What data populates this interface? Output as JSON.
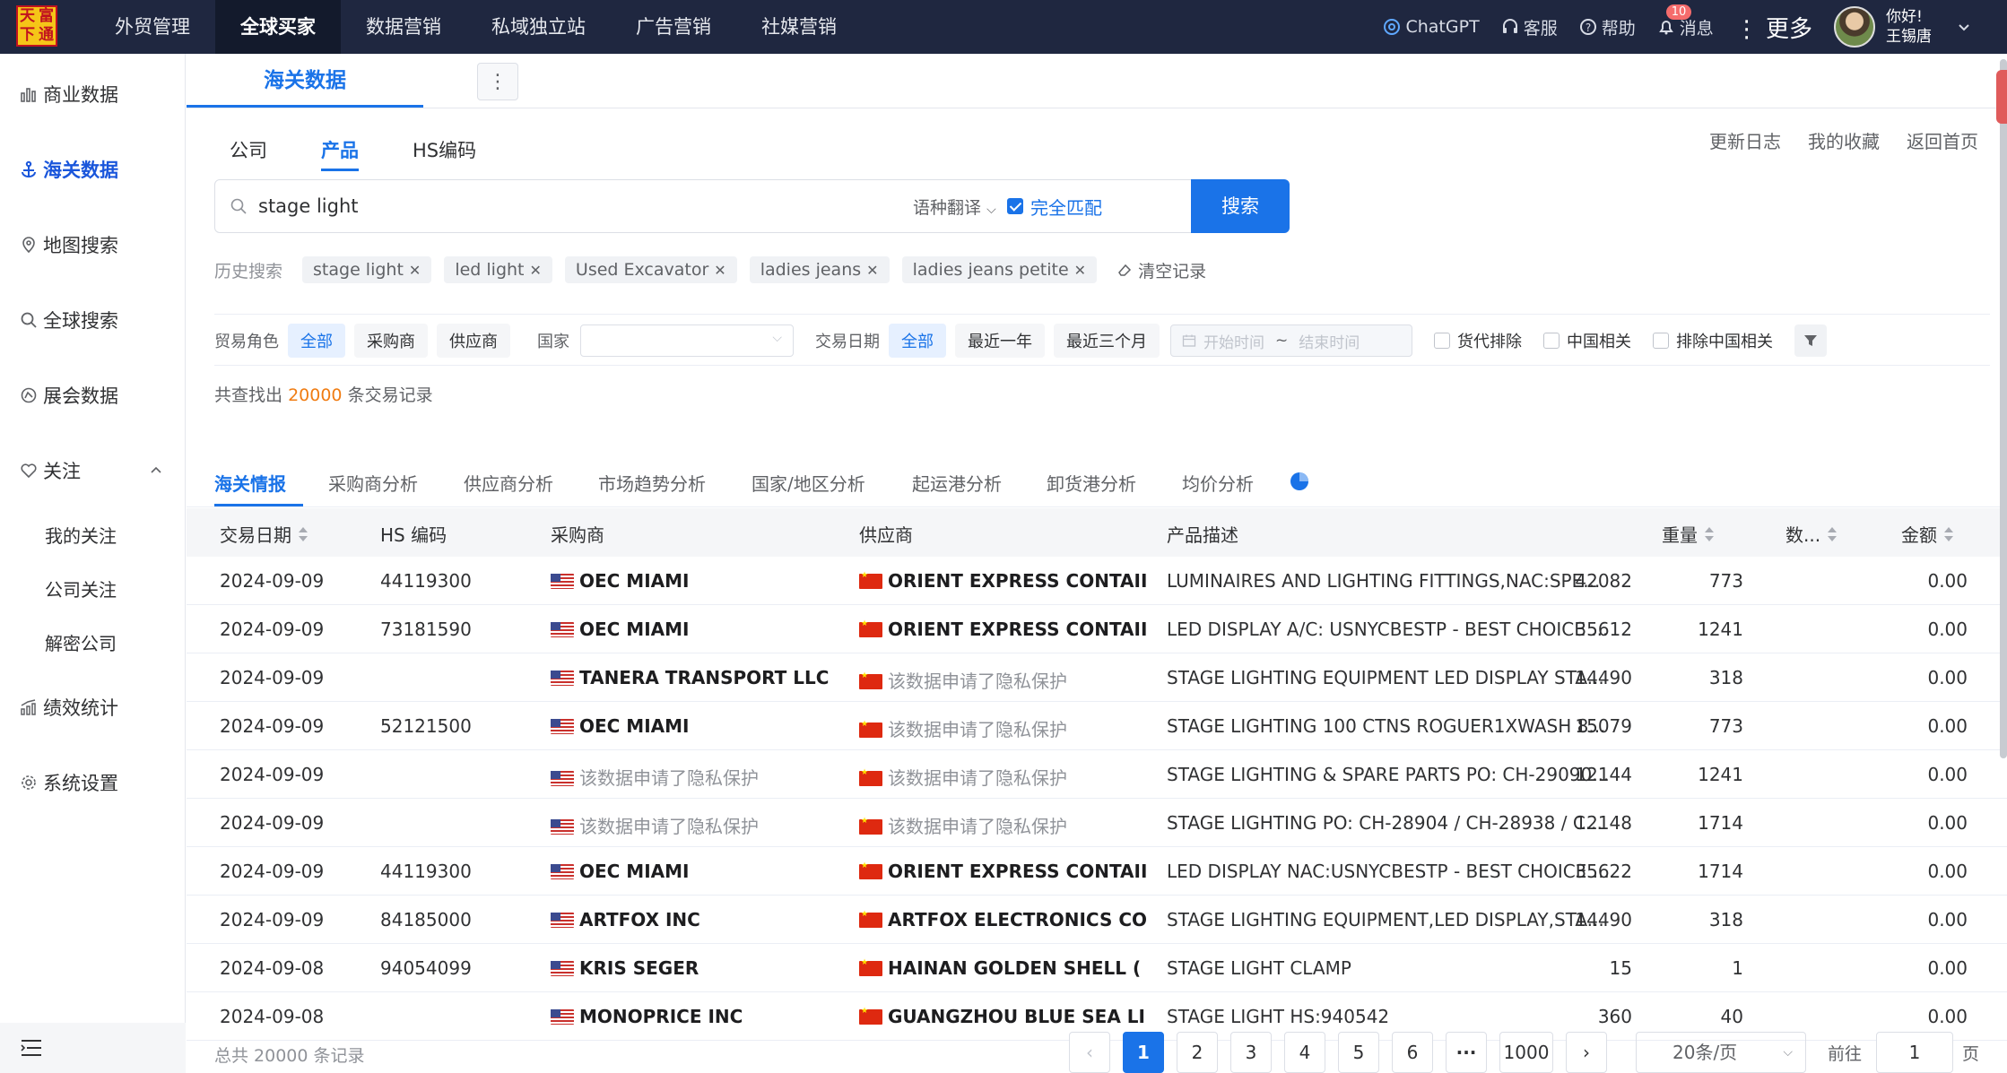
{
  "logo": {
    "chars": [
      "天",
      "富",
      "下",
      "通"
    ]
  },
  "topnav": [
    {
      "label": "外贸管理",
      "active": false
    },
    {
      "label": "全球买家",
      "active": true
    },
    {
      "label": "数据营销",
      "active": false
    },
    {
      "label": "私域独立站",
      "active": false
    },
    {
      "label": "广告营销",
      "active": false
    },
    {
      "label": "社媒营销",
      "active": false
    }
  ],
  "topright": {
    "chatgpt": "ChatGPT",
    "service": "客服",
    "help": "帮助",
    "messages": "消息",
    "message_count": "10",
    "more": "⋮ 更多",
    "greeting": "你好!",
    "username": "王锡唐"
  },
  "sidebar": {
    "items": [
      "商业数据",
      "海关数据",
      "地图搜索",
      "全球搜索",
      "展会数据",
      "关注",
      "绩效统计",
      "系统设置"
    ],
    "sub": [
      "我的关注",
      "公司关注",
      "解密公司"
    ]
  },
  "page_tab": "海关数据",
  "subtabs": [
    "公司",
    "产品",
    "HS编码"
  ],
  "toplinks": [
    "更新日志",
    "我的收藏",
    "返回首页"
  ],
  "search": {
    "value": "stage light",
    "translate": "语种翻译",
    "exact": "完全匹配",
    "button": "搜索"
  },
  "history": {
    "label": "历史搜索",
    "chips": [
      "stage light",
      "led light",
      "Used Excavator",
      "ladies jeans",
      "ladies jeans petite"
    ],
    "clear": "清空记录"
  },
  "filters": {
    "role_label": "贸易角色",
    "roles": [
      "全部",
      "采购商",
      "供应商"
    ],
    "country_label": "国家",
    "date_label": "交易日期",
    "dates": [
      "全部",
      "最近一年",
      "最近三个月"
    ],
    "start": "开始时间",
    "tilde": "~",
    "end": "结束时间",
    "checks": [
      "货代排除",
      "中国相关",
      "排除中国相关"
    ]
  },
  "found": {
    "prefix": "共查找出",
    "count": "20000",
    "suffix": "条交易记录"
  },
  "analysis_tabs": [
    "海关情报",
    "采购商分析",
    "供应商分析",
    "市场趋势分析",
    "国家/地区分析",
    "起运港分析",
    "卸货港分析",
    "均价分析"
  ],
  "table": {
    "headers": [
      "交易日期",
      "HS 编码",
      "采购商",
      "供应商",
      "产品描述",
      "重量",
      "数...",
      "金额"
    ],
    "rows": [
      {
        "date": "2024-09-09",
        "hs": "44119300",
        "buyer": "OEC MIAMI",
        "buyer_priv": false,
        "supplier": "ORIENT EXPRESS CONTAII",
        "supplier_priv": false,
        "desc": "LUMINAIRES AND LIGHTING FITTINGS,NAC:SPE...",
        "weight": "42082",
        "qty": "773",
        "amount": "0.00"
      },
      {
        "date": "2024-09-09",
        "hs": "73181590",
        "buyer": "OEC MIAMI",
        "buyer_priv": false,
        "supplier": "ORIENT EXPRESS CONTAII",
        "supplier_priv": false,
        "desc": "LED DISPLAY A/C: USNYCBESTP - BEST CHOICE ...",
        "weight": "35612",
        "qty": "1241",
        "amount": "0.00"
      },
      {
        "date": "2024-09-09",
        "hs": "",
        "buyer": "TANERA TRANSPORT LLC",
        "buyer_priv": false,
        "supplier": "该数据申请了隐私保护",
        "supplier_priv": true,
        "desc": "STAGE LIGHTING EQUIPMENT LED DISPLAY STA...",
        "weight": "14490",
        "qty": "318",
        "amount": "0.00"
      },
      {
        "date": "2024-09-09",
        "hs": "52121500",
        "buyer": "OEC MIAMI",
        "buyer_priv": false,
        "supplier": "该数据申请了隐私保护",
        "supplier_priv": true,
        "desc": "STAGE LIGHTING 100 CTNS ROGUER1XWASH 8...",
        "weight": "15079",
        "qty": "773",
        "amount": "0.00"
      },
      {
        "date": "2024-09-09",
        "hs": "",
        "buyer": "该数据申请了隐私保护",
        "buyer_priv": true,
        "supplier": "该数据申请了隐私保护",
        "supplier_priv": true,
        "desc": "STAGE LIGHTING & SPARE PARTS PO: CH-29090...",
        "weight": "12144",
        "qty": "1241",
        "amount": "0.00"
      },
      {
        "date": "2024-09-09",
        "hs": "",
        "buyer": "该数据申请了隐私保护",
        "buyer_priv": true,
        "supplier": "该数据申请了隐私保护",
        "supplier_priv": true,
        "desc": "STAGE LIGHTING PO: CH-28904 / CH-28938 / C...",
        "weight": "12148",
        "qty": "1714",
        "amount": "0.00"
      },
      {
        "date": "2024-09-09",
        "hs": "44119300",
        "buyer": "OEC MIAMI",
        "buyer_priv": false,
        "supplier": "ORIENT EXPRESS CONTAII",
        "supplier_priv": false,
        "desc": "LED DISPLAY NAC:USNYCBESTP - BEST CHOICE ...",
        "weight": "35622",
        "qty": "1714",
        "amount": "0.00"
      },
      {
        "date": "2024-09-09",
        "hs": "84185000",
        "buyer": "ARTFOX INC",
        "buyer_priv": false,
        "supplier": "ARTFOX ELECTRONICS CO",
        "supplier_priv": false,
        "desc": "STAGE LIGHTING EQUIPMENT,LED DISPLAY,STA...",
        "weight": "14490",
        "qty": "318",
        "amount": "0.00"
      },
      {
        "date": "2024-09-08",
        "hs": "94054099",
        "buyer": "KRIS SEGER",
        "buyer_priv": false,
        "supplier": "HAINAN GOLDEN SHELL (",
        "supplier_priv": false,
        "desc": "STAGE LIGHT CLAMP",
        "weight": "15",
        "qty": "1",
        "amount": "0.00"
      },
      {
        "date": "2024-09-08",
        "hs": "",
        "buyer": "MONOPRICE INC",
        "buyer_priv": false,
        "supplier": "GUANGZHOU BLUE SEA LI",
        "supplier_priv": false,
        "desc": "STAGE LIGHT HS:940542",
        "weight": "360",
        "qty": "40",
        "amount": "0.00"
      }
    ]
  },
  "pager": {
    "total": "总共 20000 条记录",
    "prev": "‹",
    "pages": [
      "1",
      "2",
      "3",
      "4",
      "5",
      "6",
      "···",
      "1000"
    ],
    "next": "›",
    "size": "20条/页",
    "goto": "前往",
    "goto_value": "1",
    "page_unit": "页"
  }
}
